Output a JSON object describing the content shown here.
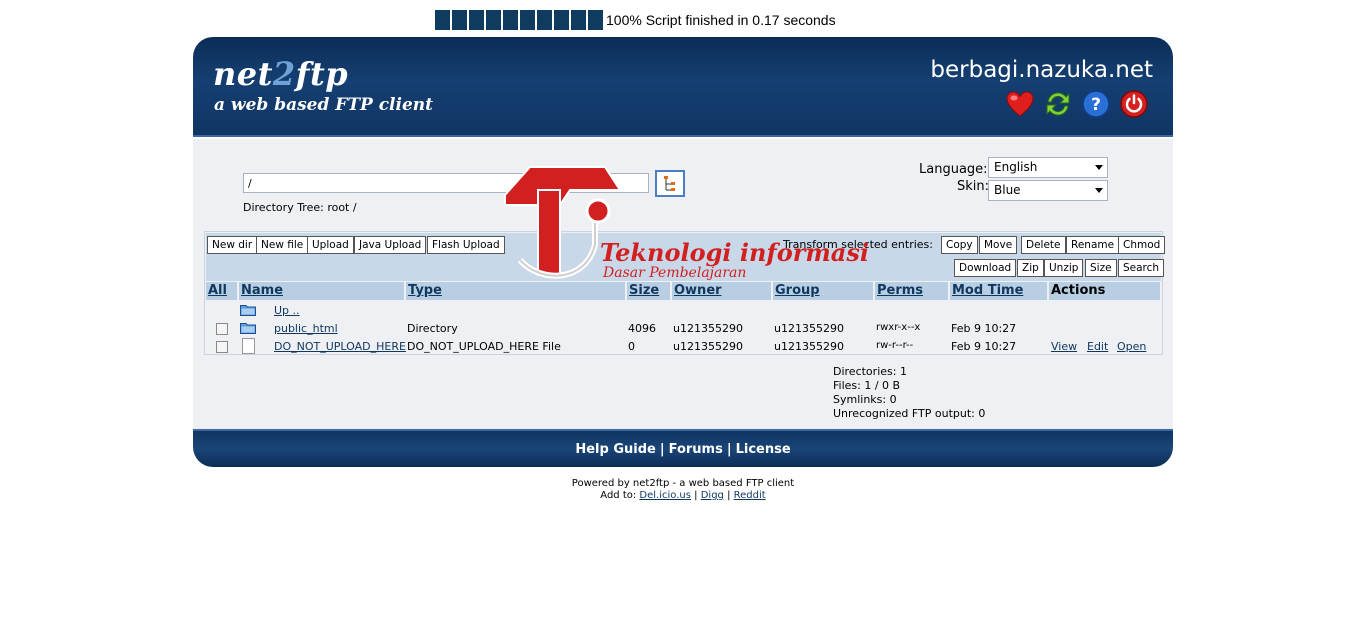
{
  "progress": {
    "block_count": 10,
    "text": "100% Script finished in 0.17 seconds"
  },
  "header": {
    "logo_main_a": "net",
    "logo_main_b": "2",
    "logo_main_c": "ftp",
    "logo_sub": "a web based FTP client",
    "site_name": "berbagi.nazuka.net",
    "icons": [
      "heart-icon",
      "refresh-icon",
      "help-icon",
      "power-icon"
    ]
  },
  "nav": {
    "path_value": "/",
    "directory_tree": "Directory Tree: root /",
    "language_label": "Language:",
    "language_value": "English",
    "skin_label": "Skin:",
    "skin_value": "Blue"
  },
  "toolbar": {
    "new_dir": "New dir",
    "new_file": "New file",
    "upload": "Upload",
    "java_upload": "Java Upload",
    "flash_upload": "Flash Upload",
    "transform_label": "Transform selected entries:",
    "copy": "Copy",
    "move": "Move",
    "delete": "Delete",
    "rename": "Rename",
    "chmod": "Chmod",
    "download": "Download",
    "zip": "Zip",
    "unzip": "Unzip",
    "size": "Size",
    "search": "Search"
  },
  "table": {
    "headers": {
      "all": "All",
      "name": "Name",
      "type": "Type",
      "size": "Size",
      "owner": "Owner",
      "group": "Group",
      "perms": "Perms",
      "mod_time": "Mod Time",
      "actions": "Actions"
    },
    "up_label": "Up ..",
    "rows": [
      {
        "name": "public_html",
        "type": "Directory",
        "size": "4096",
        "owner": "u121355290",
        "group": "u121355290",
        "perms": "rwxr-x--x",
        "mod_time": "Feb 9 10:27"
      },
      {
        "name": "DO_NOT_UPLOAD_HERE",
        "type": "DO_NOT_UPLOAD_HERE File",
        "size": "0",
        "owner": "u121355290",
        "group": "u121355290",
        "perms": "rw-r--r--",
        "mod_time": "Feb 9 10:27",
        "actions": [
          "View",
          "Edit",
          "Open"
        ]
      }
    ]
  },
  "stats": {
    "directories": "Directories: 1",
    "files": "Files: 1 / 0 B",
    "symlinks": "Symlinks: 0",
    "unrecognized": "Unrecognized FTP output: 0"
  },
  "footer": {
    "help_guide": "Help Guide",
    "forums": "Forums",
    "license": "License",
    "sep": "|"
  },
  "powered": {
    "line1": "Powered by net2ftp - a web based FTP client",
    "add_to": "Add to:",
    "delicious": "Del.icio.us",
    "digg": "Digg",
    "reddit": "Reddit",
    "sep": "|"
  },
  "watermark": {
    "title": "Teknologi informasi",
    "subtitle": "Dasar Pembelajaran",
    "colors": {
      "red": "#d21f1f",
      "white": "#ffffff"
    }
  },
  "colors": {
    "header_blue": "#0b2d57",
    "panel_bg": "#eef0f3",
    "toolbar_bg": "#c8d8e8",
    "column_head_bg": "#b8cfe3",
    "link": "#10375f"
  }
}
